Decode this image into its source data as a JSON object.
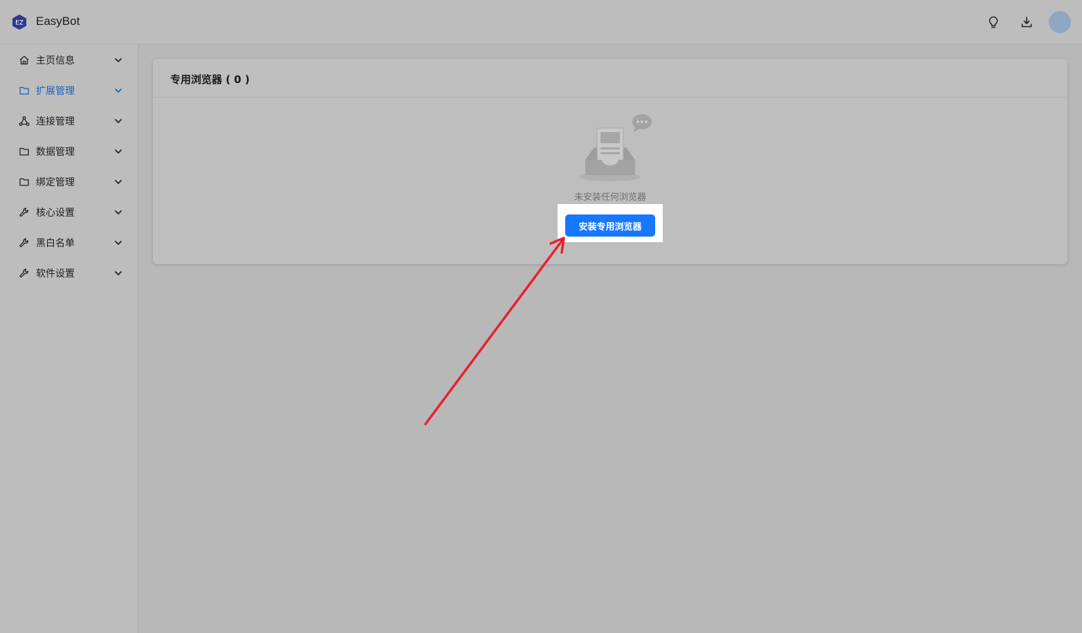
{
  "app": {
    "title": "EasyBot",
    "logo_text": "EZ"
  },
  "header": {
    "icons": [
      "lightbulb-icon",
      "download-icon"
    ],
    "avatar_color": "#8ea7c3"
  },
  "sidebar": {
    "items": [
      {
        "label": "主页信息",
        "icon": "home-icon",
        "active": false
      },
      {
        "label": "扩展管理",
        "icon": "folder-icon",
        "active": true
      },
      {
        "label": "连接管理",
        "icon": "network-icon",
        "active": false
      },
      {
        "label": "数据管理",
        "icon": "folder-icon",
        "active": false
      },
      {
        "label": "绑定管理",
        "icon": "folder-icon",
        "active": false
      },
      {
        "label": "核心设置",
        "icon": "wrench-icon",
        "active": false
      },
      {
        "label": "黑白名单",
        "icon": "wrench-icon",
        "active": false
      },
      {
        "label": "软件设置",
        "icon": "wrench-icon",
        "active": false
      }
    ]
  },
  "main": {
    "card_title": "专用浏览器 ( 0 )",
    "empty_text": "未安装任何浏览器",
    "install_button": "安装专用浏览器"
  },
  "colors": {
    "accent": "#1677ff",
    "active_nav": "#1f5fc4",
    "annotation_arrow": "#e8212e"
  }
}
